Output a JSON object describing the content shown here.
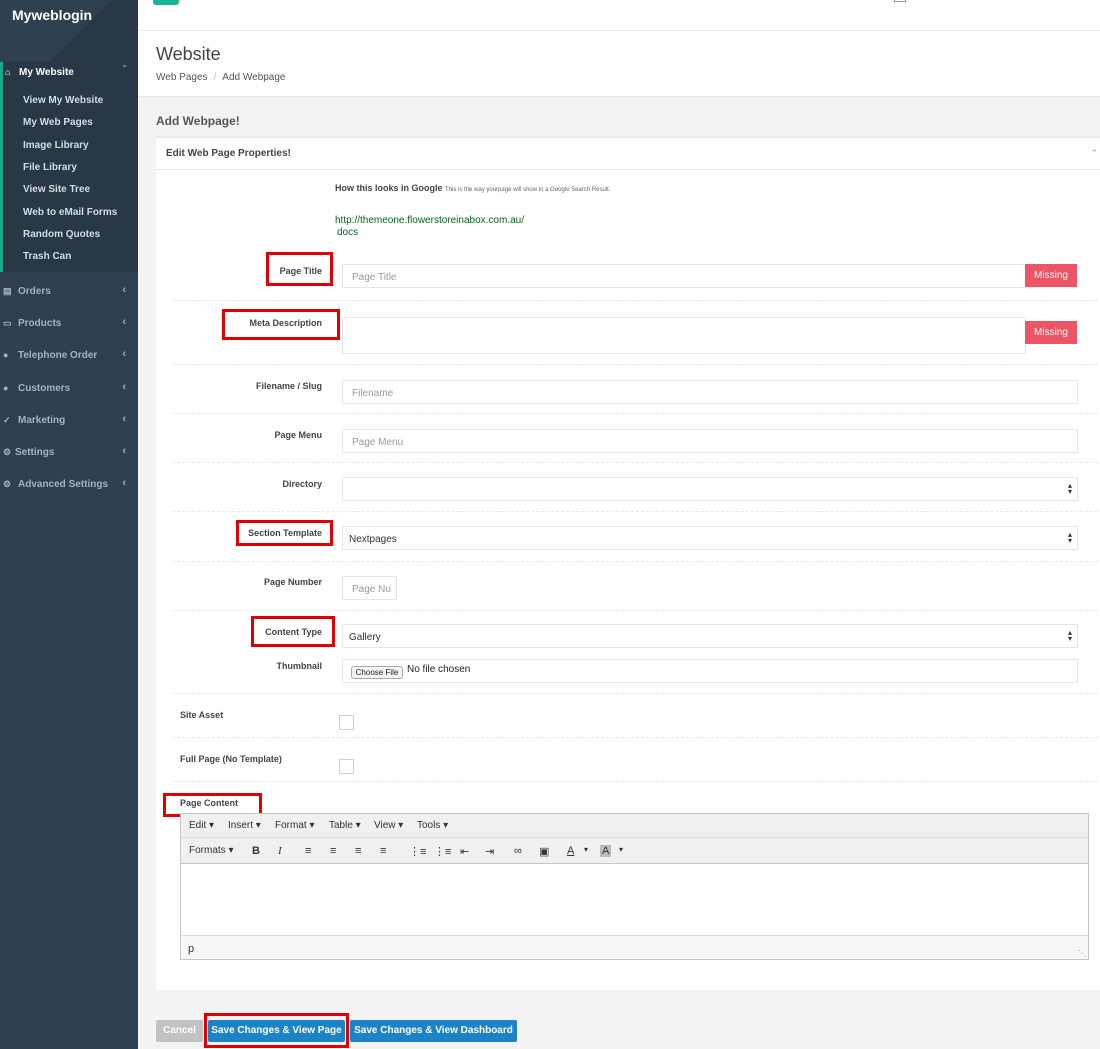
{
  "brand": "Myweblogin",
  "sidebar": {
    "active": {
      "label": "My Website",
      "icon": "home-icon"
    },
    "sub_items": [
      "View My Website",
      "My Web Pages",
      "Image Library",
      "File Library",
      "View Site Tree",
      "Web to eMail Forms",
      "Random Quotes",
      "Trash Can"
    ],
    "items": [
      {
        "label": "Orders",
        "icon": "bar-chart-icon"
      },
      {
        "label": "Products",
        "icon": "desktop-icon"
      },
      {
        "label": "Telephone Order",
        "icon": "users-icon"
      },
      {
        "label": "Customers",
        "icon": "users-icon"
      },
      {
        "label": "Marketing",
        "icon": "wrench-icon"
      },
      {
        "label": "Settings",
        "icon": "gear-icon"
      },
      {
        "label": "Advanced Settings",
        "icon": "gears-icon"
      }
    ]
  },
  "header": {
    "title": "Website",
    "breadcrumb": [
      "Web Pages",
      "Add Webpage"
    ]
  },
  "section_title": "Add Webpage!",
  "panel_title": "Edit Web Page Properties!",
  "google_preview": {
    "label": "How this looks in Google",
    "note": "This is the way yourpage will show in a Google Search Result.",
    "url": "http://themeone.flowerstoreinabox.com.au/",
    "path": "docs"
  },
  "form": {
    "page_title": {
      "label": "Page Title",
      "placeholder": "Page Title",
      "status": "Missing"
    },
    "meta_description": {
      "label": "Meta Description",
      "status": "Missing"
    },
    "filename": {
      "label": "Filename / Slug",
      "placeholder": "Filename"
    },
    "page_menu": {
      "label": "Page Menu",
      "placeholder": "Page Menu"
    },
    "directory": {
      "label": "Directory",
      "value": ""
    },
    "section_template": {
      "label": "Section Template",
      "value": "Nextpages"
    },
    "page_number": {
      "label": "Page Number",
      "placeholder": "Page Nu"
    },
    "content_type": {
      "label": "Content Type",
      "value": "Gallery"
    },
    "thumbnail": {
      "label": "Thumbnail",
      "button": "Choose File",
      "status": "No file chosen"
    },
    "site_asset": {
      "label": "Site Asset"
    },
    "full_page": {
      "label": "Full Page (No Template)"
    },
    "page_content": {
      "label": "Page Content"
    }
  },
  "editor": {
    "menus": [
      "Edit",
      "Insert",
      "Format",
      "Table",
      "View",
      "Tools"
    ],
    "formats_label": "Formats",
    "status_path": "p"
  },
  "buttons": {
    "cancel": "Cancel",
    "save_view_page": "Save Changes & View Page",
    "save_view_dashboard": "Save Changes & View Dashboard"
  },
  "colors": {
    "sidebar": "#2f4050",
    "accent": "#1ab394",
    "danger": "#ed5565",
    "primary": "#1c84c6",
    "highlight": "#e00000"
  }
}
